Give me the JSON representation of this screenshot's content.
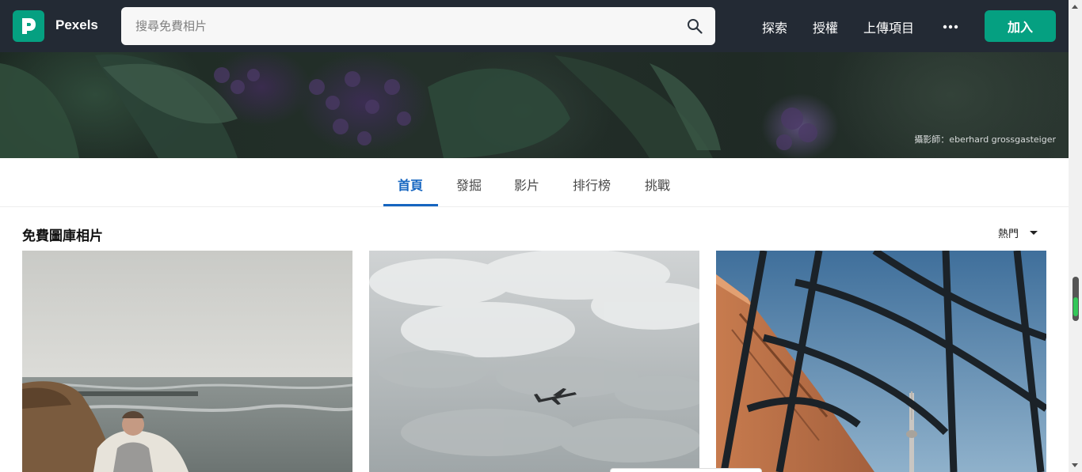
{
  "app": {
    "brand": "Pexels",
    "logo_letter": "P",
    "brand_color": "#05a081",
    "header_bg": "#232a34"
  },
  "search": {
    "placeholder": "搜尋免費相片",
    "value": "",
    "icon": "search-icon"
  },
  "nav": {
    "links": [
      "探索",
      "授權",
      "上傳項目"
    ],
    "more_icon": "more-dots-icon",
    "join_label": "加入"
  },
  "hero": {
    "credit": "攝影師：eberhard grossgasteiger"
  },
  "tabs": {
    "items": [
      "首頁",
      "發掘",
      "影片",
      "排行榜",
      "挑戰"
    ],
    "active": "首頁",
    "active_color": "#1565c0"
  },
  "section": {
    "title": "免費圖庫相片",
    "sort_label": "熱門",
    "sort_icon": "caret-down-icon"
  },
  "photos": [
    {
      "subject": "man-by-sea",
      "icon": "photo-thumbnail"
    },
    {
      "subject": "airplane-in-clouds",
      "icon": "photo-thumbnail"
    },
    {
      "subject": "building-tower-window",
      "icon": "photo-thumbnail"
    }
  ]
}
